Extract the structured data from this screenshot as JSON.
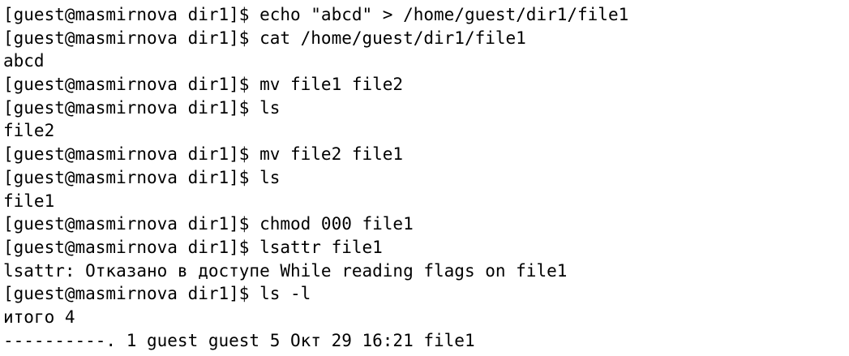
{
  "terminal": {
    "partial_top": "[guest@masmirnova dir1]$ echo \"abcd\" > /home/guest/dir1/file1",
    "lines": [
      "[guest@masmirnova dir1]$ echo \"abcd\" > /home/guest/dir1/file1",
      "[guest@masmirnova dir1]$ cat /home/guest/dir1/file1",
      "abcd",
      "[guest@masmirnova dir1]$ mv file1 file2",
      "[guest@masmirnova dir1]$ ls",
      "file2",
      "[guest@masmirnova dir1]$ mv file2 file1",
      "[guest@masmirnova dir1]$ ls",
      "file1",
      "[guest@masmirnova dir1]$ chmod 000 file1",
      "[guest@masmirnova dir1]$ lsattr file1",
      "lsattr: Отказано в доступе While reading flags on file1",
      "[guest@masmirnova dir1]$ ls -l",
      "итого 4",
      "----------. 1 guest guest 5 Окт 29 16:21 file1"
    ]
  }
}
